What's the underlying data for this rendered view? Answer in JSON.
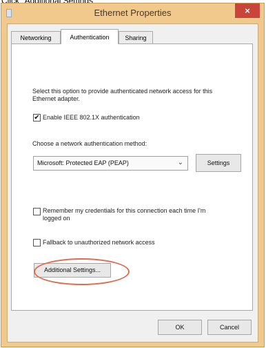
{
  "caption": "Click \"Additional Settings\"",
  "window": {
    "title": "Ethernet Properties",
    "close_symbol": "×"
  },
  "tabs": [
    {
      "label": "Networking",
      "active": false
    },
    {
      "label": "Authentication",
      "active": true
    },
    {
      "label": "Sharing",
      "active": false
    }
  ],
  "auth": {
    "description": "Select this option to provide authenticated network access for this Ethernet adapter.",
    "enable_checked": true,
    "enable_label": "Enable IEEE 802.1X authentication",
    "method_label": "Choose a network authentication method:",
    "method_value": "Microsoft: Protected EAP (PEAP)",
    "settings_button": "Settings",
    "remember_checked": false,
    "remember_label": "Remember my credentials for this connection each time I'm logged on",
    "fallback_checked": false,
    "fallback_label": "Fallback to unauthorized network access",
    "additional_button": "Additional Settings..."
  },
  "footer": {
    "ok_label": "OK",
    "cancel_label": "Cancel"
  },
  "icons": {
    "check": "✔",
    "dropdown": "⌄"
  },
  "colors": {
    "frame": "#f2c98c",
    "close": "#c9443a",
    "highlight": "#e16b4b"
  }
}
